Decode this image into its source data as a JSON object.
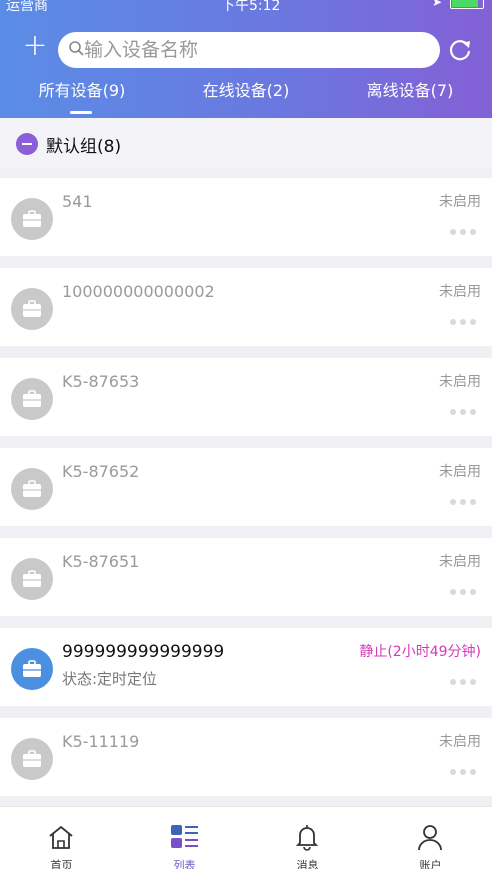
{
  "status_bar": {
    "carrier": "运营商",
    "time": "下午5:12"
  },
  "search": {
    "placeholder": "输入设备名称"
  },
  "tabs": [
    {
      "label": "所有设备(9)",
      "selected": true
    },
    {
      "label": "在线设备(2)",
      "selected": false
    },
    {
      "label": "离线设备(7)",
      "selected": false
    }
  ],
  "group": {
    "label": "默认组(8)"
  },
  "devices": [
    {
      "name": "541",
      "status": "未启用",
      "active": false
    },
    {
      "name": "100000000000002",
      "status": "未启用",
      "active": false
    },
    {
      "name": "K5-87653",
      "status": "未启用",
      "active": false
    },
    {
      "name": "K5-87652",
      "status": "未启用",
      "active": false
    },
    {
      "name": "K5-87651",
      "status": "未启用",
      "active": false
    },
    {
      "name": "999999999999999",
      "status": "静止(2小时49分钟)",
      "sub": "状态:定时定位",
      "active": true
    },
    {
      "name": "K5-11119",
      "status": "未启用",
      "active": false
    }
  ],
  "tabbar": [
    {
      "label": "首页",
      "icon": "home-icon",
      "selected": false
    },
    {
      "label": "列表",
      "icon": "list-icon",
      "selected": true
    },
    {
      "label": "消息",
      "icon": "bell-icon",
      "selected": false
    },
    {
      "label": "账户",
      "icon": "user-icon",
      "selected": false
    }
  ],
  "colors": {
    "accent": "#6a5ad0",
    "active_avatar": "#4b8fe0",
    "status_active": "#d63ab8"
  }
}
